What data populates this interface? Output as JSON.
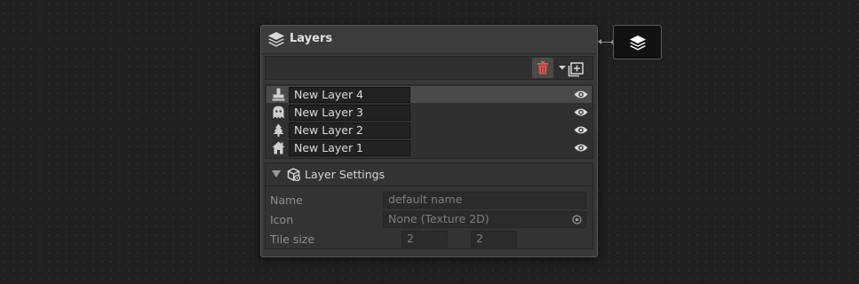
{
  "node": {
    "title": "Layers",
    "icon": "layers-stack-icon"
  },
  "toolbar": {
    "delete_icon": "trash-icon",
    "add_icon": "add-layer-dropdown-icon",
    "delete_color": "#e0574f"
  },
  "layers": [
    {
      "name": "New Layer 4",
      "icon": "stamp-icon",
      "visibility_icon": "eye-icon",
      "selected": true
    },
    {
      "name": "New Layer 3",
      "icon": "ghost-icon",
      "visibility_icon": "eye-icon",
      "selected": false
    },
    {
      "name": "New Layer 2",
      "icon": "tree-icon",
      "visibility_icon": "eye-icon",
      "selected": false
    },
    {
      "name": "New Layer 1",
      "icon": "house-icon",
      "visibility_icon": "eye-icon",
      "selected": false
    }
  ],
  "settings": {
    "title": "Layer Settings",
    "icon": "settings-cube-icon",
    "fields": {
      "name": {
        "label": "Name",
        "value": "default name"
      },
      "icon": {
        "label": "Icon",
        "value": "None (Texture 2D)"
      },
      "tile_size": {
        "label": "Tile size",
        "x": "2",
        "y": "2"
      }
    }
  },
  "port_node": {
    "icon": "layers-stack-icon"
  }
}
